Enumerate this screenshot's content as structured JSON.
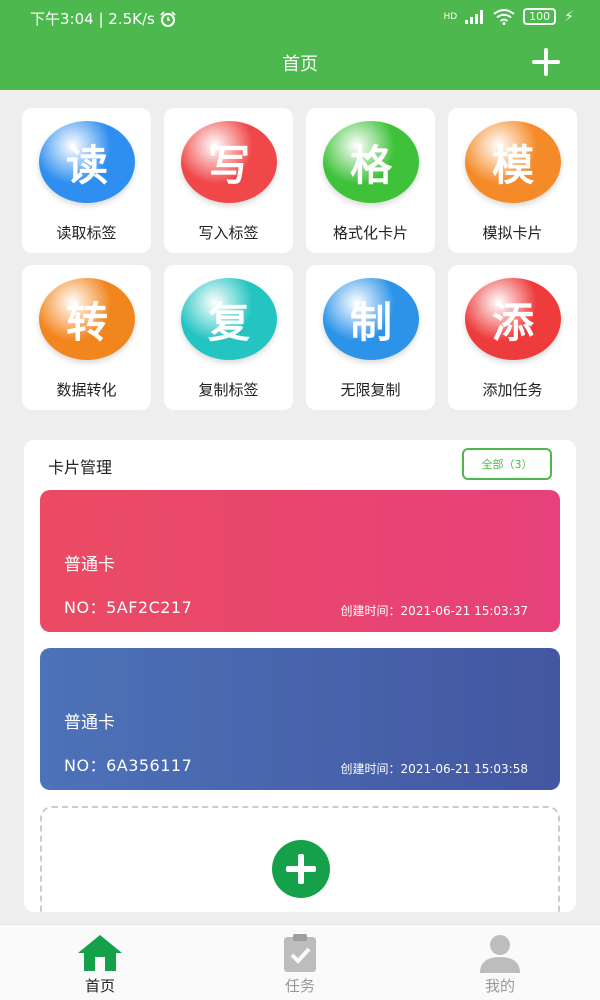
{
  "status_bar": {
    "time_speed": "下午3:04 | 2.5K/s",
    "network": "HD",
    "battery": "100"
  },
  "header": {
    "title": "首页",
    "add_icon": "plus-icon"
  },
  "functions": [
    {
      "glyph": "读",
      "label": "读取标签",
      "color": "#2f8ff0"
    },
    {
      "glyph": "写",
      "label": "写入标签",
      "color": "#f04848"
    },
    {
      "glyph": "格",
      "label": "格式化卡片",
      "color": "#3fc23a"
    },
    {
      "glyph": "模",
      "label": "模拟卡片",
      "color": "#f58a28"
    },
    {
      "glyph": "转",
      "label": "数据转化",
      "color": "#f2861e"
    },
    {
      "glyph": "复",
      "label": "复制标签",
      "color": "#23c4c2"
    },
    {
      "glyph": "制",
      "label": "无限复制",
      "color": "#2c93e8"
    },
    {
      "glyph": "添",
      "label": "添加任务",
      "color": "#ee3b3b"
    }
  ],
  "cards_panel": {
    "title": "卡片管理",
    "all_button": "全部（3）",
    "cards": [
      {
        "type": "普通卡",
        "no": "NO：5AF2C217",
        "created": "创建时间：2021-06-21 15:03:37"
      },
      {
        "type": "普通卡",
        "no": "NO：6A356117",
        "created": "创建时间：2021-06-21 15:03:58"
      }
    ]
  },
  "tab_bar": {
    "tabs": [
      {
        "label": "首页",
        "icon": "home-icon",
        "active": true
      },
      {
        "label": "任务",
        "icon": "clipboard-check-icon",
        "active": false
      },
      {
        "label": "我的",
        "icon": "user-icon",
        "active": false
      }
    ]
  },
  "colors": {
    "brand_green": "#4cb84e",
    "add_green": "#15a14a"
  }
}
